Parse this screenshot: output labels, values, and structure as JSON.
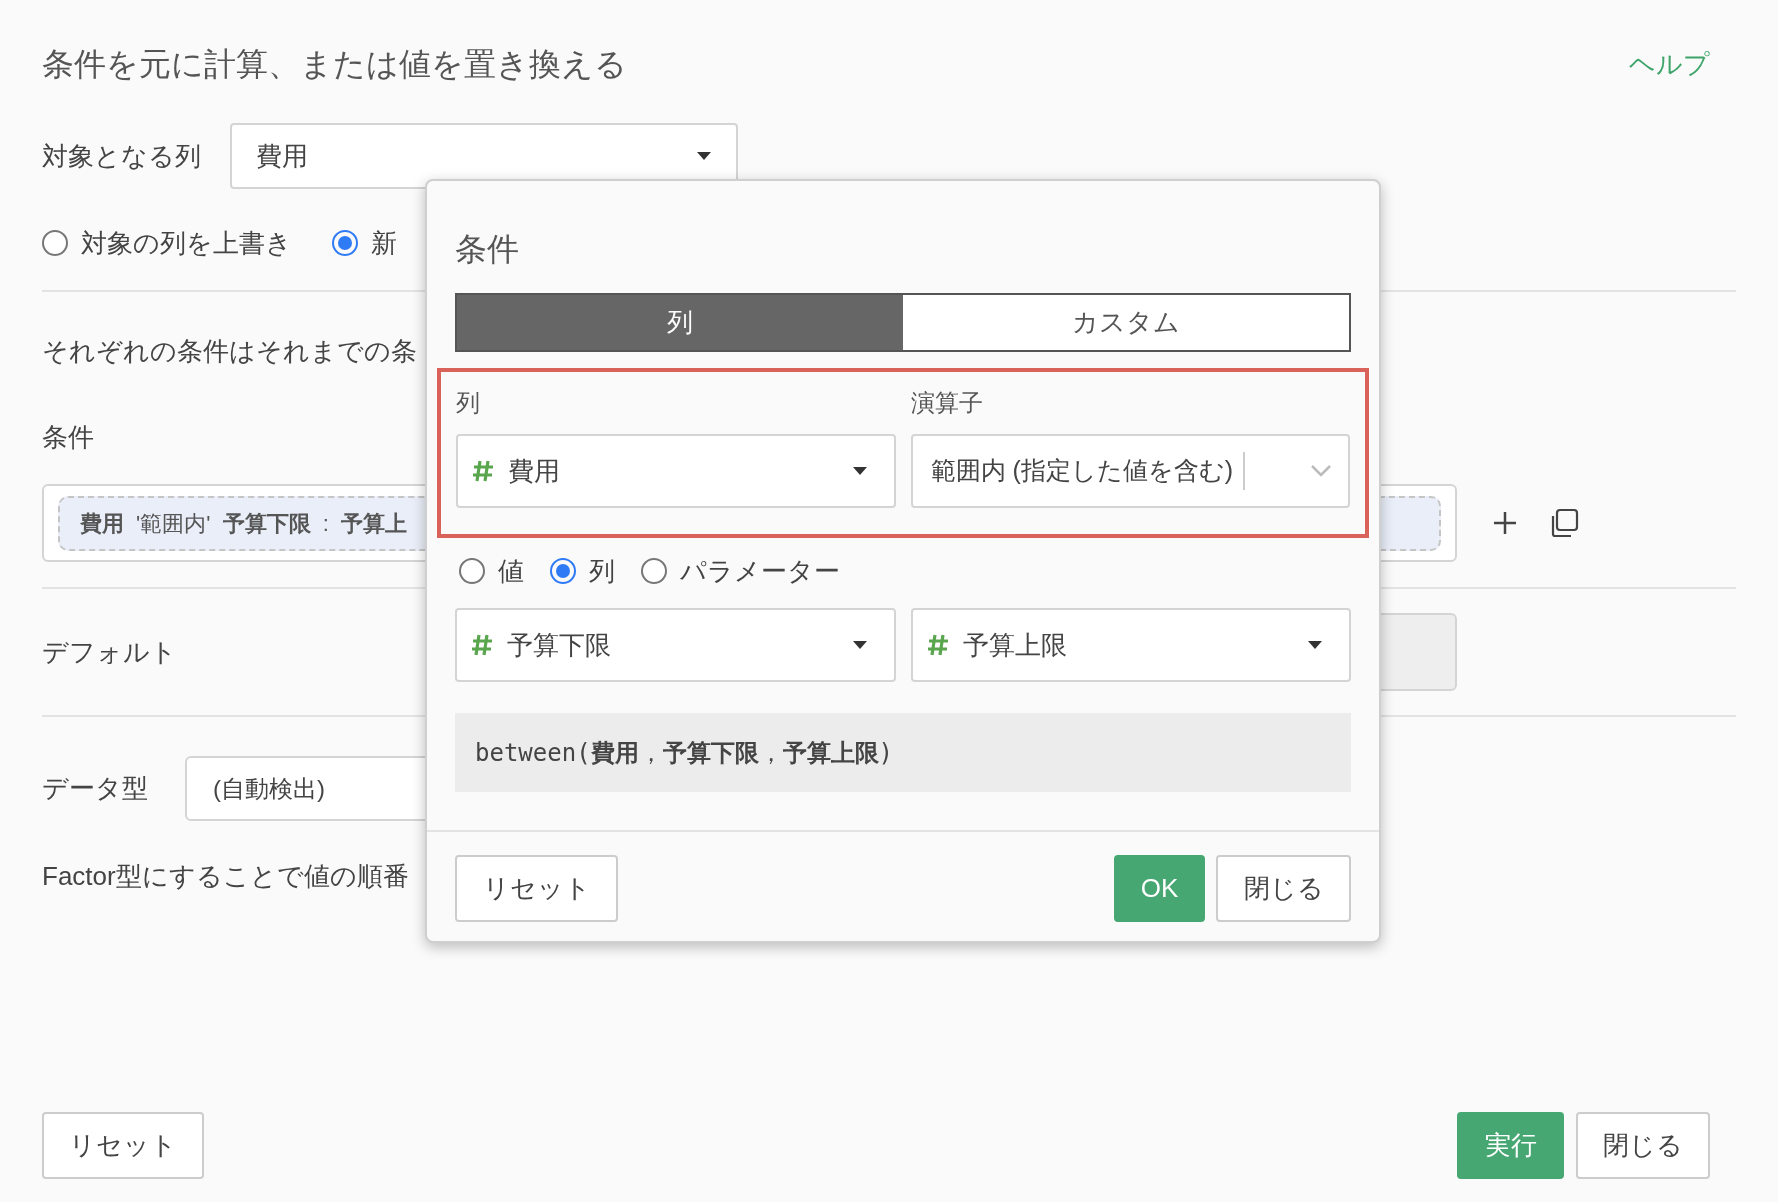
{
  "title": "条件を元に計算、または値を置き換える",
  "help_link": "ヘルプ",
  "target_column": {
    "label": "対象となる列",
    "value": "費用"
  },
  "write_mode": [
    {
      "label": "対象の列を上書き",
      "selected": false
    },
    {
      "label": "新",
      "selected": true
    }
  ],
  "description": "それぞれの条件はそれまでの条",
  "conditions": {
    "label": "条件",
    "chip": "**費用** '範囲内' **予算下限** : **予算上**"
  },
  "default": {
    "label": "デフォルト",
    "disabled": true
  },
  "data_type": {
    "label": "データ型",
    "value": "(自動検出)"
  },
  "note": "Factor型にすることで値の順番",
  "buttons": [
    {
      "label": "リセット",
      "kind": "secondary"
    },
    {
      "label": "実行",
      "kind": "primary"
    },
    {
      "label": "閉じる",
      "kind": "secondary"
    }
  ],
  "dialog": {
    "title": "条件",
    "tabs": [
      {
        "label": "列",
        "selected": true
      },
      {
        "label": "カスタム",
        "selected": false
      }
    ],
    "criteria": {
      "highlighted": true,
      "column": {
        "label": "列",
        "value": "費用"
      },
      "operator": {
        "label": "演算子",
        "value": "範囲内 (指定した値を含む)"
      }
    },
    "value_type": [
      {
        "label": "値",
        "selected": false
      },
      {
        "label": "列",
        "selected": true
      },
      {
        "label": "パラメーター",
        "selected": false
      }
    ],
    "lower": {
      "value": "予算下限"
    },
    "upper": {
      "value": "予算上限"
    },
    "expression": "between(**費用**， **予算下限**， **予算上限**)",
    "buttons": [
      {
        "label": "リセット",
        "kind": "secondary"
      },
      {
        "label": "OK",
        "kind": "primary"
      },
      {
        "label": "閉じる",
        "kind": "secondary"
      }
    ]
  }
}
